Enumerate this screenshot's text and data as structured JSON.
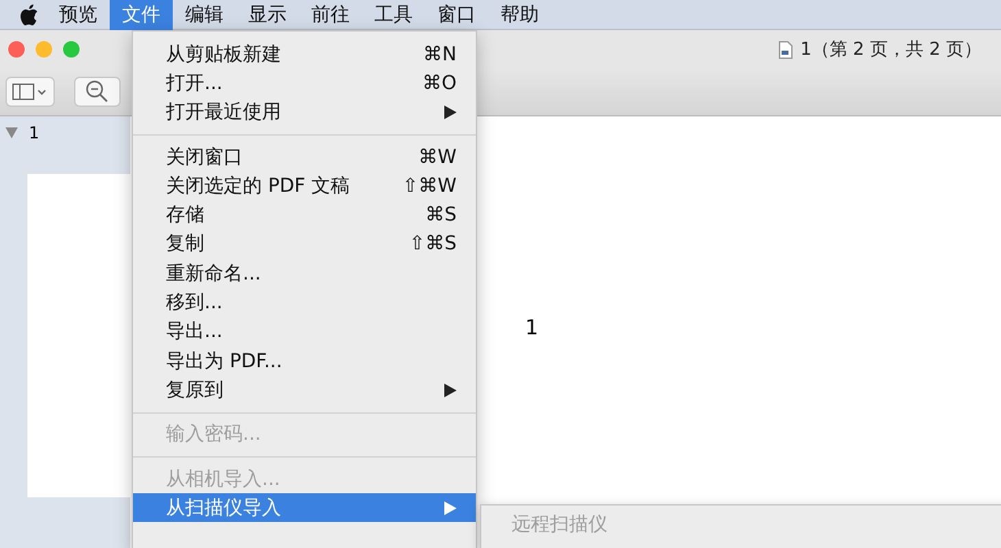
{
  "menubar": {
    "items": [
      {
        "label": "预览",
        "selected": false
      },
      {
        "label": "文件",
        "selected": true
      },
      {
        "label": "编辑",
        "selected": false
      },
      {
        "label": "显示",
        "selected": false
      },
      {
        "label": "前往",
        "selected": false
      },
      {
        "label": "工具",
        "selected": false
      },
      {
        "label": "窗口",
        "selected": false
      },
      {
        "label": "帮助",
        "selected": false
      }
    ]
  },
  "window": {
    "title": "1（第 2 页，共 2 页）",
    "sidebar": {
      "items": [
        {
          "label": "1",
          "expanded": true
        }
      ]
    },
    "page_text": "1"
  },
  "menu": {
    "items": [
      {
        "kind": "item",
        "label": "从剪贴板新建",
        "shortcut": "⌘N",
        "disabled": false,
        "submenu": false,
        "selected": false
      },
      {
        "kind": "item",
        "label": "打开...",
        "shortcut": "⌘O",
        "disabled": false,
        "submenu": false,
        "selected": false
      },
      {
        "kind": "item",
        "label": "打开最近使用",
        "disabled": false,
        "submenu": true,
        "selected": false
      },
      {
        "kind": "separator"
      },
      {
        "kind": "item",
        "label": "关闭窗口",
        "shortcut": "⌘W",
        "disabled": false,
        "submenu": false,
        "selected": false
      },
      {
        "kind": "item",
        "label": "关闭选定的 PDF 文稿",
        "shortcut": "⇧⌘W",
        "disabled": false,
        "submenu": false,
        "selected": false
      },
      {
        "kind": "item",
        "label": "存储",
        "shortcut": "⌘S",
        "disabled": false,
        "submenu": false,
        "selected": false
      },
      {
        "kind": "item",
        "label": "复制",
        "shortcut": "⇧⌘S",
        "disabled": false,
        "submenu": false,
        "selected": false
      },
      {
        "kind": "item",
        "label": "重新命名...",
        "disabled": false,
        "submenu": false,
        "selected": false
      },
      {
        "kind": "item",
        "label": "移到...",
        "disabled": false,
        "submenu": false,
        "selected": false
      },
      {
        "kind": "item",
        "label": "导出...",
        "disabled": false,
        "submenu": false,
        "selected": false
      },
      {
        "kind": "item",
        "label": "导出为 PDF...",
        "disabled": false,
        "submenu": false,
        "selected": false
      },
      {
        "kind": "item",
        "label": "复原到",
        "disabled": false,
        "submenu": true,
        "selected": false
      },
      {
        "kind": "separator"
      },
      {
        "kind": "item",
        "label": "输入密码...",
        "disabled": true,
        "submenu": false,
        "selected": false
      },
      {
        "kind": "separator"
      },
      {
        "kind": "item",
        "label": "从相机导入...",
        "disabled": true,
        "submenu": false,
        "selected": false
      },
      {
        "kind": "item",
        "label": "从扫描仪导入",
        "disabled": false,
        "submenu": true,
        "selected": true
      }
    ]
  },
  "submenu": {
    "items": [
      {
        "label": "远程扫描仪",
        "disabled": true
      }
    ]
  }
}
